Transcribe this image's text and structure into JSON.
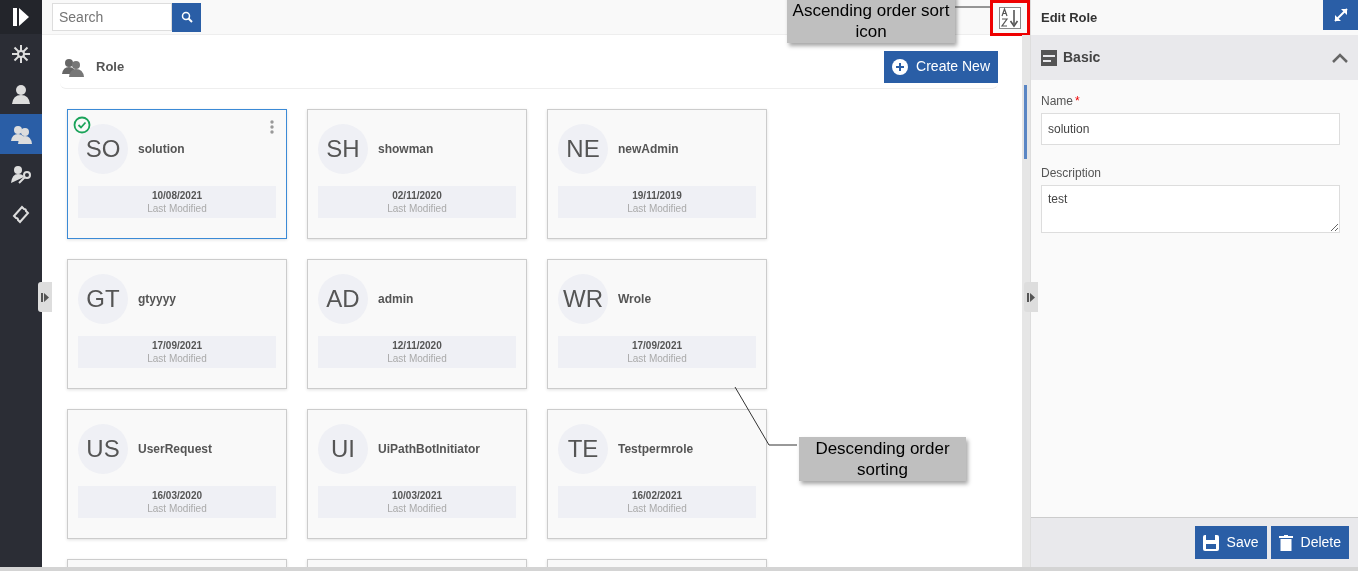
{
  "search": {
    "placeholder": "Search"
  },
  "sidebar": {
    "items": [
      {
        "kind": "network",
        "selected": false
      },
      {
        "kind": "user",
        "selected": false
      },
      {
        "kind": "users",
        "selected": true
      },
      {
        "kind": "user-key",
        "selected": false
      },
      {
        "kind": "ticket",
        "selected": false
      }
    ]
  },
  "page": {
    "title": "Role",
    "create_button": "Create New"
  },
  "roles": [
    {
      "initials": "SO",
      "name": "solution",
      "date": "10/08/2021",
      "date_label": "Last Modified",
      "selected": true
    },
    {
      "initials": "SH",
      "name": "showman",
      "date": "02/11/2020",
      "date_label": "Last Modified",
      "selected": false
    },
    {
      "initials": "NE",
      "name": "newAdmin",
      "date": "19/11/2019",
      "date_label": "Last Modified",
      "selected": false
    },
    {
      "initials": "GT",
      "name": "gtyyyy",
      "date": "17/09/2021",
      "date_label": "Last Modified",
      "selected": false
    },
    {
      "initials": "AD",
      "name": "admin",
      "date": "12/11/2020",
      "date_label": "Last Modified",
      "selected": false
    },
    {
      "initials": "WR",
      "name": "Wrole",
      "date": "17/09/2021",
      "date_label": "Last Modified",
      "selected": false
    },
    {
      "initials": "US",
      "name": "UserRequest",
      "date": "16/03/2020",
      "date_label": "Last Modified",
      "selected": false
    },
    {
      "initials": "UI",
      "name": "UiPathBotInitiator",
      "date": "10/03/2021",
      "date_label": "Last Modified",
      "selected": false
    },
    {
      "initials": "TE",
      "name": "Testpermrole",
      "date": "16/02/2021",
      "date_label": "Last Modified",
      "selected": false
    }
  ],
  "edit_panel": {
    "title": "Edit Role",
    "section": {
      "title": "Basic",
      "expanded": true
    },
    "fields": [
      {
        "kind": "text",
        "label": "Name",
        "required_mark": "*",
        "value": "solution"
      },
      {
        "kind": "textarea",
        "label": "Description",
        "value": "test"
      }
    ],
    "buttons": [
      {
        "kind": "save",
        "label": "Save"
      },
      {
        "kind": "delete",
        "label": "Delete"
      }
    ]
  },
  "annotations": [
    {
      "text": "Ascending order sort icon"
    },
    {
      "text": "Descending order sorting"
    }
  ]
}
